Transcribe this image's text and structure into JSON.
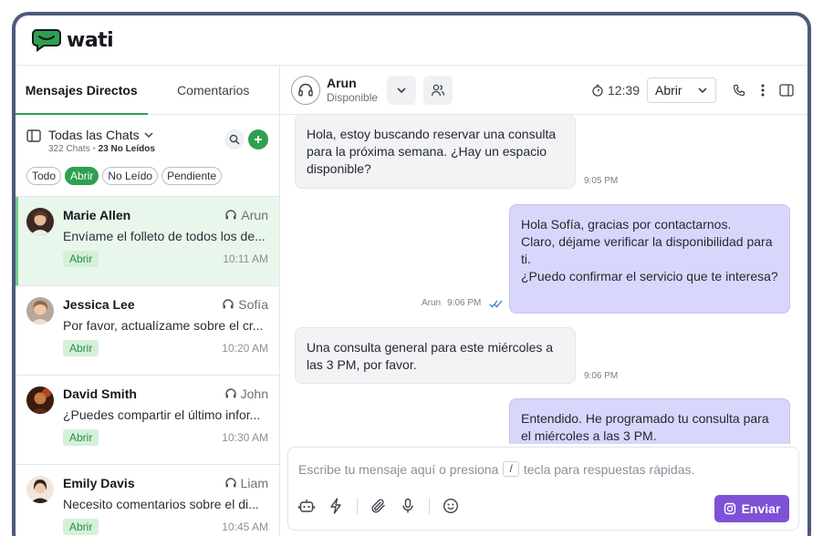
{
  "app": {
    "logo_text": "wati",
    "brand_color": "#2ea04f",
    "accent_purple": "#7d52d6"
  },
  "tabs": [
    {
      "label": "Mensajes Directos",
      "active": true
    },
    {
      "label": "Comentarios",
      "active": false
    }
  ],
  "filter": {
    "title": "Todas las Chats",
    "total": "322 Chats",
    "unread": "23 No Leídos",
    "chips": [
      {
        "label": "Todo",
        "active": false
      },
      {
        "label": "Abrir",
        "active": true
      },
      {
        "label": "No Leído",
        "active": false
      },
      {
        "label": "Pendiente",
        "active": false
      }
    ]
  },
  "chats": [
    {
      "name": "Marie Allen",
      "agent": "Arun",
      "message": "Envíame el folleto de todos los de...",
      "status": "Abrir",
      "time": "10:11 AM",
      "selected": true
    },
    {
      "name": "Jessica Lee",
      "agent": "Sofía",
      "message": "Por favor, actualízame sobre el cr...",
      "status": "Abrir",
      "time": "10:20 AM",
      "selected": false
    },
    {
      "name": "David Smith",
      "agent": "John",
      "message": "¿Puedes compartir el último infor...",
      "status": "Abrir",
      "time": "10:30 AM",
      "selected": false
    },
    {
      "name": "Emily Davis",
      "agent": "Liam",
      "message": "Necesito comentarios sobre el di...",
      "status": "Abrir",
      "time": "10:45 AM",
      "selected": false
    }
  ],
  "conversation": {
    "agent_name": "Arun",
    "agent_status": "Disponible",
    "timer": "12:39",
    "status_value": "Abrir",
    "messages": [
      {
        "dir": "in",
        "text": "Hola, estoy buscando reservar una consulta para la próxima semana. ¿Hay un espacio disponible?",
        "time": "9:05 PM"
      },
      {
        "dir": "out",
        "lines": [
          "Hola Sofía, gracias por contactarnos.",
          "Claro, déjame verificar la disponibilidad para ti.",
          "¿Puedo confirmar el servicio que te interesa?"
        ],
        "sender": "Arun",
        "time": "9:06 PM"
      },
      {
        "dir": "in",
        "text": "Una consulta general para este miércoles a las 3 PM, por favor.",
        "time": "9:06 PM"
      },
      {
        "dir": "out",
        "text": "Entendido. He programado tu consulta para el miércoles a las 3 PM.",
        "time": ""
      }
    ]
  },
  "composer": {
    "placeholder_before": "Escribe tu mensaje aquí o presiona",
    "shortcut_key": "/",
    "placeholder_after": "tecla para respuestas rápidas.",
    "send_label": "Enviar"
  }
}
